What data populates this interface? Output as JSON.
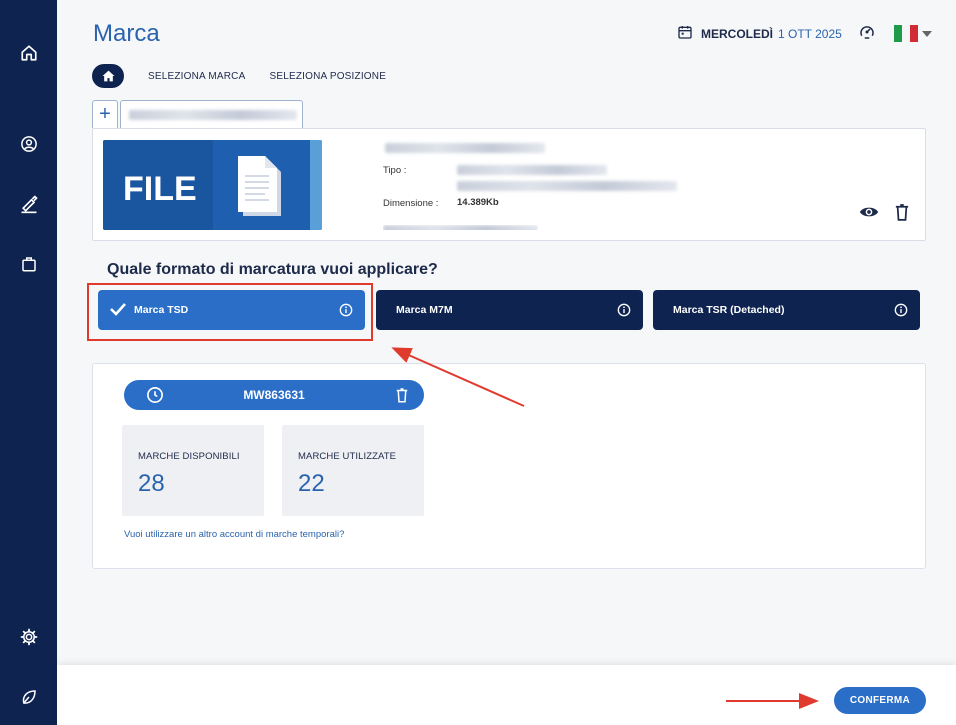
{
  "sidebar": {
    "icons": [
      "home-icon",
      "user-icon",
      "sign-icon",
      "briefcase-icon",
      "settings-icon",
      "leaf-icon"
    ]
  },
  "header": {
    "title": "Marca",
    "date_day": "MERCOLEDÌ",
    "date_value": "1 OTT 2025",
    "language": "IT"
  },
  "tabs": {
    "select_brand": "SELEZIONA MARCA",
    "select_position": "SELEZIONA POSIZIONE"
  },
  "file_card": {
    "thumbnail_text": "FILE",
    "type_label": "Tipo :",
    "dimension_label": "Dimensione :",
    "dimension_value": "14.389Kb"
  },
  "question": "Quale formato di marcatura vuoi applicare?",
  "formats": [
    {
      "label": "Marca TSD",
      "selected": true
    },
    {
      "label": "Marca M7M",
      "selected": false
    },
    {
      "label": "Marca TSR (Detached)",
      "selected": false
    }
  ],
  "account": {
    "code": "MW863631",
    "available_label": "MARCHE DISPONIBILI",
    "available_value": "28",
    "used_label": "MARCHE UTILIZZATE",
    "used_value": "22",
    "other_account_link": "Vuoi utilizzare un altro account di marche temporali?"
  },
  "footer": {
    "confirm_label": "CONFERMA"
  },
  "colors": {
    "navy": "#0e2350",
    "accent": "#2a6ec8",
    "annotation_red": "#e03a2f"
  }
}
